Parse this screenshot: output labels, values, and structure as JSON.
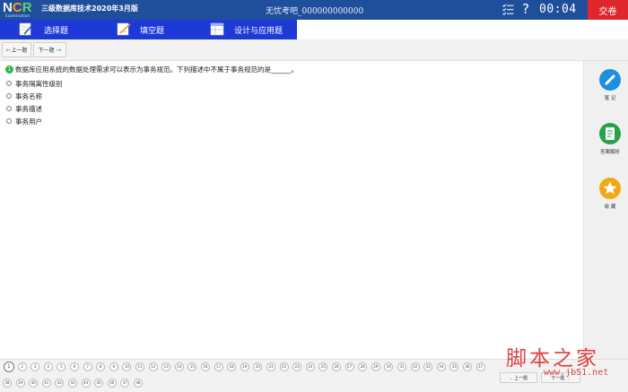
{
  "titlebar": {
    "logo_letters": [
      "N",
      "C",
      "R"
    ],
    "logo_sub": "Examination",
    "app_title": "三级数据库技术2020年3月版",
    "exam_id": "无忧考吧_000000000000",
    "timer": "00:04",
    "submit_label": "交卷",
    "icons": [
      "checklist-icon",
      "help-icon"
    ],
    "help_glyph": "?"
  },
  "tabs": [
    {
      "label": "选择题",
      "icon": "pencil-paper-icon"
    },
    {
      "label": "填空题",
      "icon": "edit-paper-icon"
    },
    {
      "label": "设计与应用题",
      "icon": "table-window-icon"
    }
  ],
  "nav": {
    "prev_label": "上一题",
    "next_label": "下一题",
    "prev_arrow": "←",
    "next_arrow": "→"
  },
  "question": {
    "number": "1",
    "text": "数据库应用系统的数据处理需求可以表示为事务规范。下列描述中不属于事务规范的是______。",
    "options": [
      "事务隔离性级别",
      "事务名称",
      "事务描述",
      "事务用户"
    ]
  },
  "sidebar": {
    "notes_label": "笔 记",
    "analysis_label": "答案解析",
    "favorite_label": "收 藏"
  },
  "number_strip": {
    "row1": [
      "1",
      "2",
      "3",
      "4",
      "5",
      "6",
      "7",
      "8",
      "9",
      "10",
      "11",
      "12",
      "13",
      "14",
      "15",
      "16",
      "17",
      "18",
      "19",
      "20",
      "21",
      "22",
      "23",
      "24",
      "25",
      "26",
      "27",
      "28",
      "29",
      "30",
      "31",
      "32",
      "33",
      "34",
      "35",
      "36",
      "37"
    ],
    "row2": [
      "38",
      "39",
      "40",
      "41",
      "42",
      "43",
      "44",
      "45",
      "46",
      "47",
      "48"
    ],
    "current": "1",
    "prev_label": "上一题",
    "next_label": "下一题"
  },
  "watermark": {
    "text": "脚本之家",
    "url": "www.jb51.net"
  },
  "colors": {
    "titlebar": "#1f4f9a",
    "tabbar": "#1d39d6",
    "submit": "#e0262d",
    "question_badge": "#33b24a",
    "notes": "#1e8fe0",
    "analysis": "#2aa04a",
    "favorite": "#f2a812"
  }
}
